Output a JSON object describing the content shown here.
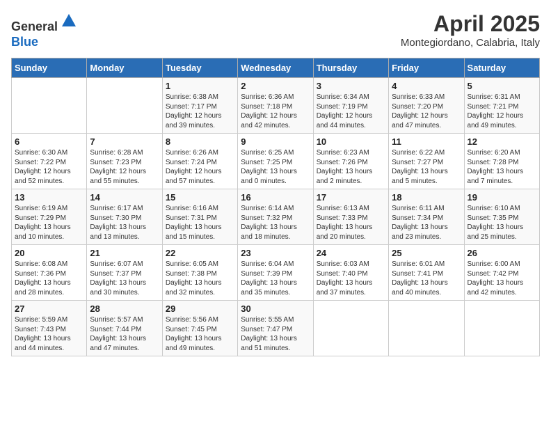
{
  "header": {
    "logo_line1": "General",
    "logo_line2": "Blue",
    "month_title": "April 2025",
    "subtitle": "Montegiordano, Calabria, Italy"
  },
  "days_of_week": [
    "Sunday",
    "Monday",
    "Tuesday",
    "Wednesday",
    "Thursday",
    "Friday",
    "Saturday"
  ],
  "weeks": [
    [
      {
        "day": "",
        "info": ""
      },
      {
        "day": "",
        "info": ""
      },
      {
        "day": "1",
        "info": "Sunrise: 6:38 AM\nSunset: 7:17 PM\nDaylight: 12 hours and 39 minutes."
      },
      {
        "day": "2",
        "info": "Sunrise: 6:36 AM\nSunset: 7:18 PM\nDaylight: 12 hours and 42 minutes."
      },
      {
        "day": "3",
        "info": "Sunrise: 6:34 AM\nSunset: 7:19 PM\nDaylight: 12 hours and 44 minutes."
      },
      {
        "day": "4",
        "info": "Sunrise: 6:33 AM\nSunset: 7:20 PM\nDaylight: 12 hours and 47 minutes."
      },
      {
        "day": "5",
        "info": "Sunrise: 6:31 AM\nSunset: 7:21 PM\nDaylight: 12 hours and 49 minutes."
      }
    ],
    [
      {
        "day": "6",
        "info": "Sunrise: 6:30 AM\nSunset: 7:22 PM\nDaylight: 12 hours and 52 minutes."
      },
      {
        "day": "7",
        "info": "Sunrise: 6:28 AM\nSunset: 7:23 PM\nDaylight: 12 hours and 55 minutes."
      },
      {
        "day": "8",
        "info": "Sunrise: 6:26 AM\nSunset: 7:24 PM\nDaylight: 12 hours and 57 minutes."
      },
      {
        "day": "9",
        "info": "Sunrise: 6:25 AM\nSunset: 7:25 PM\nDaylight: 13 hours and 0 minutes."
      },
      {
        "day": "10",
        "info": "Sunrise: 6:23 AM\nSunset: 7:26 PM\nDaylight: 13 hours and 2 minutes."
      },
      {
        "day": "11",
        "info": "Sunrise: 6:22 AM\nSunset: 7:27 PM\nDaylight: 13 hours and 5 minutes."
      },
      {
        "day": "12",
        "info": "Sunrise: 6:20 AM\nSunset: 7:28 PM\nDaylight: 13 hours and 7 minutes."
      }
    ],
    [
      {
        "day": "13",
        "info": "Sunrise: 6:19 AM\nSunset: 7:29 PM\nDaylight: 13 hours and 10 minutes."
      },
      {
        "day": "14",
        "info": "Sunrise: 6:17 AM\nSunset: 7:30 PM\nDaylight: 13 hours and 13 minutes."
      },
      {
        "day": "15",
        "info": "Sunrise: 6:16 AM\nSunset: 7:31 PM\nDaylight: 13 hours and 15 minutes."
      },
      {
        "day": "16",
        "info": "Sunrise: 6:14 AM\nSunset: 7:32 PM\nDaylight: 13 hours and 18 minutes."
      },
      {
        "day": "17",
        "info": "Sunrise: 6:13 AM\nSunset: 7:33 PM\nDaylight: 13 hours and 20 minutes."
      },
      {
        "day": "18",
        "info": "Sunrise: 6:11 AM\nSunset: 7:34 PM\nDaylight: 13 hours and 23 minutes."
      },
      {
        "day": "19",
        "info": "Sunrise: 6:10 AM\nSunset: 7:35 PM\nDaylight: 13 hours and 25 minutes."
      }
    ],
    [
      {
        "day": "20",
        "info": "Sunrise: 6:08 AM\nSunset: 7:36 PM\nDaylight: 13 hours and 28 minutes."
      },
      {
        "day": "21",
        "info": "Sunrise: 6:07 AM\nSunset: 7:37 PM\nDaylight: 13 hours and 30 minutes."
      },
      {
        "day": "22",
        "info": "Sunrise: 6:05 AM\nSunset: 7:38 PM\nDaylight: 13 hours and 32 minutes."
      },
      {
        "day": "23",
        "info": "Sunrise: 6:04 AM\nSunset: 7:39 PM\nDaylight: 13 hours and 35 minutes."
      },
      {
        "day": "24",
        "info": "Sunrise: 6:03 AM\nSunset: 7:40 PM\nDaylight: 13 hours and 37 minutes."
      },
      {
        "day": "25",
        "info": "Sunrise: 6:01 AM\nSunset: 7:41 PM\nDaylight: 13 hours and 40 minutes."
      },
      {
        "day": "26",
        "info": "Sunrise: 6:00 AM\nSunset: 7:42 PM\nDaylight: 13 hours and 42 minutes."
      }
    ],
    [
      {
        "day": "27",
        "info": "Sunrise: 5:59 AM\nSunset: 7:43 PM\nDaylight: 13 hours and 44 minutes."
      },
      {
        "day": "28",
        "info": "Sunrise: 5:57 AM\nSunset: 7:44 PM\nDaylight: 13 hours and 47 minutes."
      },
      {
        "day": "29",
        "info": "Sunrise: 5:56 AM\nSunset: 7:45 PM\nDaylight: 13 hours and 49 minutes."
      },
      {
        "day": "30",
        "info": "Sunrise: 5:55 AM\nSunset: 7:47 PM\nDaylight: 13 hours and 51 minutes."
      },
      {
        "day": "",
        "info": ""
      },
      {
        "day": "",
        "info": ""
      },
      {
        "day": "",
        "info": ""
      }
    ]
  ]
}
